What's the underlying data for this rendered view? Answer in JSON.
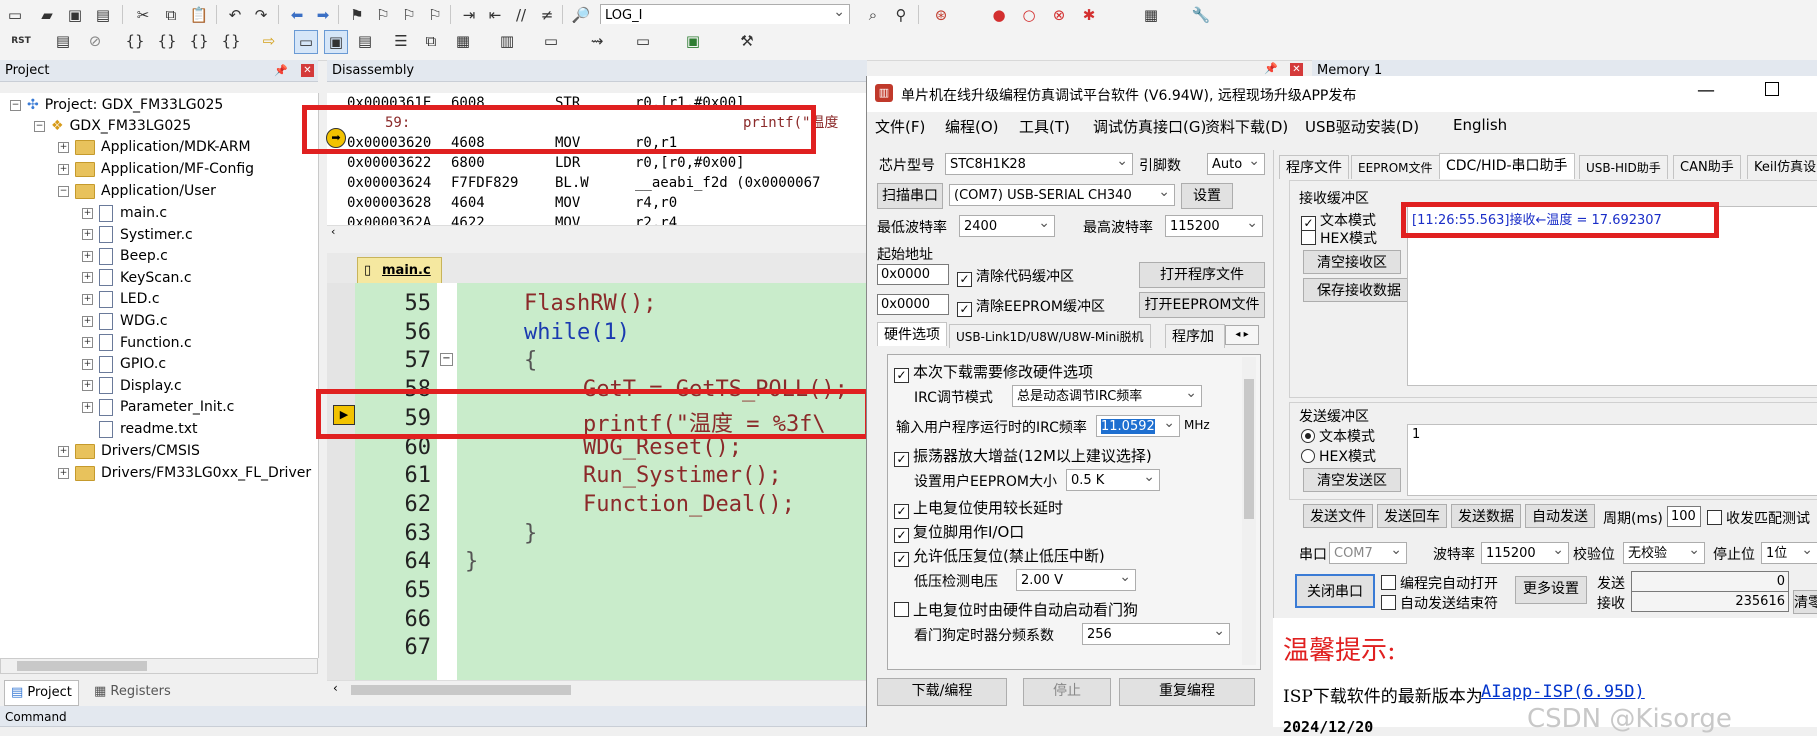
{
  "toolbar1": {
    "config_value": "LOG_I"
  },
  "toolbar2": {
    "rst_label": "RST"
  },
  "project_panel": {
    "title": "Project",
    "root": "Project: GDX_FM33LG025",
    "target": "GDX_FM33LG025",
    "groups": [
      {
        "label": "Application/MDK-ARM",
        "expand": "+"
      },
      {
        "label": "Application/MF-Config",
        "expand": "+"
      },
      {
        "label": "Application/User",
        "expand": "−"
      }
    ],
    "files": [
      "main.c",
      "Systimer.c",
      "Beep.c",
      "KeyScan.c",
      "LED.c",
      "WDG.c",
      "Function.c",
      "GPIO.c",
      "Display.c",
      "Parameter_Init.c",
      "readme.txt"
    ],
    "groups2": [
      {
        "label": "Drivers/CMSIS",
        "expand": "+"
      },
      {
        "label": "Drivers/FM33LG0xx_FL_Driver",
        "expand": "+"
      }
    ],
    "bottom_tabs": [
      "Project",
      "Registers"
    ]
  },
  "disassembly": {
    "title": "Disassembly",
    "lines": [
      {
        "addr": "0x0000361E",
        "hex": "6008",
        "op": "STR",
        "args": "r0,[r1,#0x00]"
      },
      {
        "addr": "59:",
        "hex": "",
        "op": "",
        "args": "printf(\"温度"
      },
      {
        "addr": "0x00003620",
        "hex": "4608",
        "op": "MOV",
        "args": "r0,r1"
      },
      {
        "addr": "0x00003622",
        "hex": "6800",
        "op": "LDR",
        "args": "r0,[r0,#0x00]"
      },
      {
        "addr": "0x00003624",
        "hex": "F7FDF829",
        "op": "BL.W",
        "args": "__aeabi_f2d (0x0000067"
      },
      {
        "addr": "0x00003628",
        "hex": "4604",
        "op": "MOV",
        "args": "r4,r0"
      },
      {
        "addr": "0x0000362A",
        "hex": "4622",
        "op": "MOV",
        "args": "r2,r4"
      }
    ]
  },
  "editor": {
    "tab": "main.c",
    "lines": [
      {
        "n": "55",
        "code": "FlashRW();",
        "indent": 1
      },
      {
        "n": "56",
        "code": "while(1)",
        "indent": 1
      },
      {
        "n": "57",
        "code": "{",
        "indent": 1
      },
      {
        "n": "58",
        "code": "GetT = GetTS_POLL();",
        "indent": 2
      },
      {
        "n": "59",
        "code": "printf(\"温度 = %3f\\",
        "indent": 2
      },
      {
        "n": "60",
        "code": "WDG_Reset();",
        "indent": 2
      },
      {
        "n": "61",
        "code": "Run_Systimer();",
        "indent": 2
      },
      {
        "n": "62",
        "code": "Function_Deal();",
        "indent": 2
      },
      {
        "n": "63",
        "code": "}",
        "indent": 1
      },
      {
        "n": "64",
        "code": "}",
        "indent": 0
      },
      {
        "n": "65",
        "code": "",
        "indent": 0
      },
      {
        "n": "66",
        "code": "",
        "indent": 0
      },
      {
        "n": "67",
        "code": "",
        "indent": 0
      }
    ]
  },
  "bottom_panel": {
    "title": "Command"
  },
  "memory_panel": {
    "title": "Memory 1"
  },
  "stc": {
    "title": "单片机在线升级编程仿真调试平台软件 (V6.94W), 远程现场升级APP发布",
    "menu": [
      "文件(F)",
      "编程(O)",
      "工具(T)",
      "调试仿真接口(G)",
      "资料下载(D)",
      "USB驱动安装(D)",
      "English"
    ],
    "chip_label": "芯片型号",
    "chip_value": "STC8H1K28",
    "pin_label": "引脚数",
    "pin_value": "Auto",
    "scan_button": "扫描串口",
    "port_value": "(COM7) USB-SERIAL CH340",
    "settings_button": "设置",
    "min_baud_label": "最低波特率",
    "min_baud_value": "2400",
    "max_baud_label": "最高波特率",
    "max_baud_value": "115200",
    "start_addr_label": "起始地址",
    "addr1": "0x0000",
    "clear_code_label": "清除代码缓冲区",
    "open_prog_button": "打开程序文件",
    "addr2": "0x0000",
    "clear_eeprom_label": "清除EEPROM缓冲区",
    "open_eeprom_button": "打开EEPROM文件",
    "left_tabs": [
      "硬件选项",
      "USB-Link1D/U8W/U8W-Mini脱机",
      "程序加"
    ],
    "hw_options": {
      "opt1": "本次下载需要修改硬件选项",
      "irc_mode_label": "IRC调节模式",
      "irc_mode_value": "总是动态调节IRC频率",
      "irc_freq_label": "输入用户程序运行时的IRC频率",
      "irc_freq_value": "11.0592",
      "irc_unit": "MHz",
      "opt2": "振荡器放大增益(12M以上建议选择)",
      "eeprom_size_label": "设置用户EEPROM大小",
      "eeprom_size_value": "0.5 K",
      "opt3": "上电复位使用较长延时",
      "opt4": "复位脚用作I/O口",
      "opt5": "允许低压复位(禁止低压中断)",
      "lv_label": "低压检测电压",
      "lv_value": "2.00 V",
      "opt6": "上电复位时由硬件自动启动看门狗",
      "wdt_label": "看门狗定时器分频系数",
      "wdt_value": "256"
    },
    "download_button": "下载/编程",
    "stop_button": "停止",
    "reprogram_button": "重复编程",
    "right_tabs": [
      "程序文件",
      "EEPROM文件",
      "CDC/HID-串口助手",
      "USB-HID助手",
      "CAN助手",
      "Keil仿真设"
    ],
    "recv": {
      "group_label": "接收缓冲区",
      "text_mode": "文本模式",
      "hex_mode": "HEX模式",
      "clear_button": "清空接收区",
      "save_button": "保存接收数据",
      "content": "[11:26:55.563]接收←温度 = 17.692307"
    },
    "send": {
      "group_label": "发送缓冲区",
      "text_mode": "文本模式",
      "hex_mode": "HEX模式",
      "clear_button": "清空发送区",
      "content": "1"
    },
    "send_file_button": "发送文件",
    "send_cr_button": "发送回车",
    "send_data_button": "发送数据",
    "auto_send_button": "自动发送",
    "period_label": "周期(ms)",
    "period_value": "100",
    "match_label": "收发匹配测试",
    "serial_label": "串口",
    "serial_value": "COM7",
    "baud_label": "波特率",
    "baud_value": "115200",
    "parity_label": "校验位",
    "parity_value": "无校验",
    "stop_label": "停止位",
    "stop_value": "1位",
    "close_port_button": "关闭串口",
    "auto_open_label": "编程完自动打开",
    "auto_end_label": "自动发送结束符",
    "more_settings_button": "更多设置",
    "tx_label": "发送",
    "tx_count": "0",
    "rx_label": "接收",
    "rx_count": "235616",
    "clear_count_button": "清零",
    "tip_title": "温馨提示:",
    "tip_text": "ISP下载软件的最新版本为",
    "tip_link": "AIapp-ISP(6.95D)",
    "tip_date": "2024/12/20",
    "watermark": "CSDN @Kisorge"
  },
  "colors": {
    "highlight_red": "#e02020",
    "code_bg": "#c9eccb",
    "tip_red": "#e02020",
    "link_blue": "#0033cc"
  }
}
